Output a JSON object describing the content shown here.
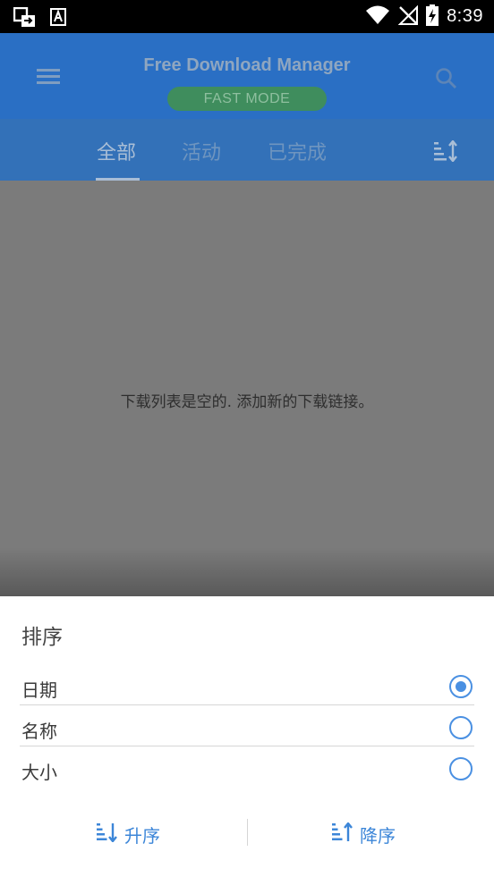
{
  "status_bar": {
    "time": "8:39",
    "icons": [
      "screen-mirror-icon",
      "font-a-icon",
      "wifi-icon",
      "no-signal-icon",
      "battery-charging-icon"
    ]
  },
  "app_bar": {
    "title": "Free Download Manager",
    "mode_badge": "FAST MODE",
    "icons": [
      "menu-icon",
      "search-icon"
    ]
  },
  "tabs": {
    "items": [
      {
        "label": "全部",
        "active": true
      },
      {
        "label": "活动",
        "active": false
      },
      {
        "label": "已完成",
        "active": false
      }
    ],
    "sort_icon": "sort-icon"
  },
  "content": {
    "empty_message": "下载列表是空的. 添加新的下载链接。"
  },
  "sort_sheet": {
    "title": "排序",
    "options": [
      {
        "label": "日期",
        "selected": true
      },
      {
        "label": "名称",
        "selected": false
      },
      {
        "label": "大小",
        "selected": false
      }
    ],
    "ascending_label": "升序",
    "descending_label": "降序"
  },
  "colors": {
    "status_bar": "#000000",
    "app_bar": "#2a6fc4",
    "tabs_bar": "#3371b8",
    "fast_mode_badge": "#3f8d5d",
    "accent": "#4a90e2",
    "dim_overlay": "#7b7b7b"
  }
}
